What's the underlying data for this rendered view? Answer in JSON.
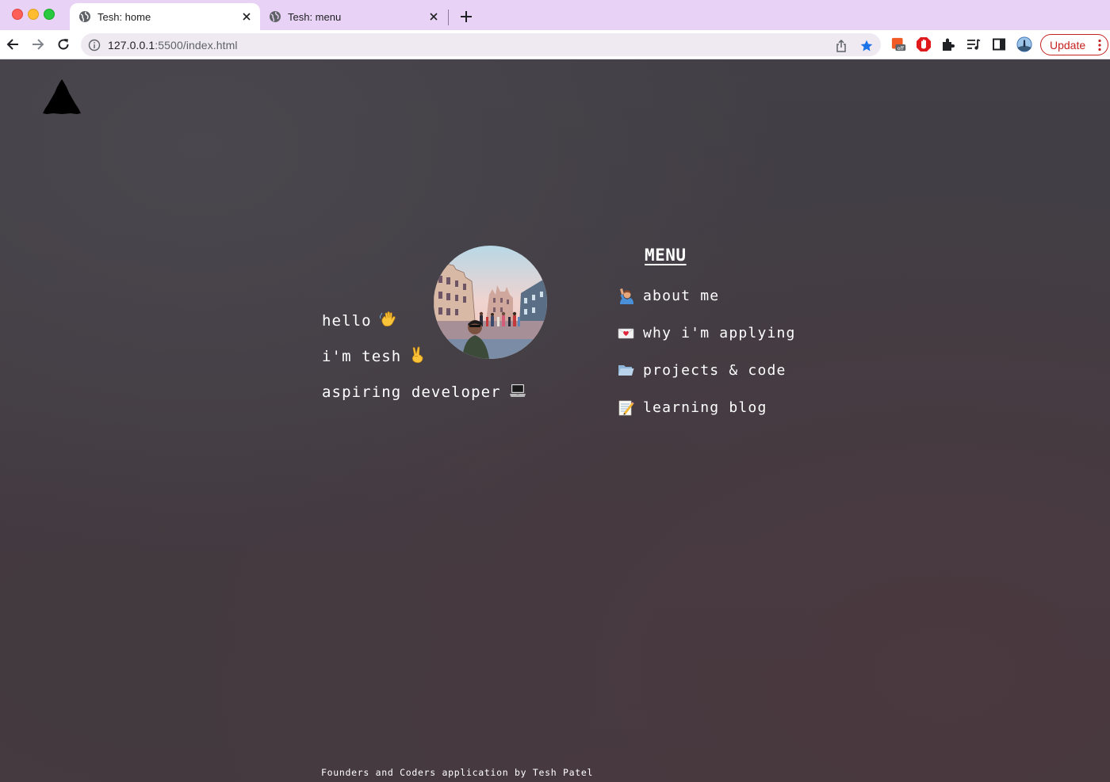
{
  "browser": {
    "tabs": [
      {
        "title": "Tesh: home",
        "active": true
      },
      {
        "title": "Tesh: menu",
        "active": false
      }
    ],
    "url_host": "127.0.0.1",
    "url_rest": ":5500/index.html",
    "update_label": "Update",
    "extension_badge": "off"
  },
  "hero": {
    "lines": [
      {
        "text": "hello",
        "icon": "waving-hand-icon"
      },
      {
        "text": "i'm tesh",
        "icon": "victory-hand-icon"
      },
      {
        "text": "aspiring developer",
        "icon": "laptop-icon"
      }
    ],
    "avatar": "profile-photo"
  },
  "menu": {
    "heading": "MENU",
    "items": [
      {
        "label": "about me",
        "icon": "person-raising-hand-icon"
      },
      {
        "label": "why i'm applying",
        "icon": "love-letter-icon"
      },
      {
        "label": "projects & code",
        "icon": "open-folder-icon"
      },
      {
        "label": "learning blog",
        "icon": "memo-icon"
      }
    ]
  },
  "footer": {
    "text": "Founders and Coders application by Tesh Patel"
  },
  "colors": {
    "tabbar": "#e8d2f6",
    "page_background": "#403a42",
    "text": "#ffffff",
    "update_button": "#c5221f"
  }
}
